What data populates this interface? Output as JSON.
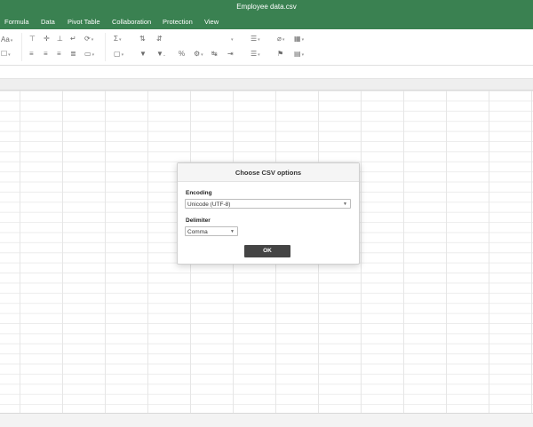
{
  "window": {
    "title": "Employee data.csv"
  },
  "menu": [
    "Formula",
    "Data",
    "Pivot Table",
    "Collaboration",
    "Protection",
    "View"
  ],
  "toolbar": {
    "font_size_glyph": "Aa",
    "sum_glyph": "Σ",
    "percent_glyph": "%"
  },
  "dialog": {
    "title": "Choose CSV options",
    "encoding_label": "Encoding",
    "encoding_value": "Unicode (UTF-8)",
    "delimiter_label": "Delimiter",
    "delimiter_value": "Comma",
    "ok_label": "OK"
  },
  "colors": {
    "brand": "#3a8151",
    "ok_button": "#444444"
  }
}
